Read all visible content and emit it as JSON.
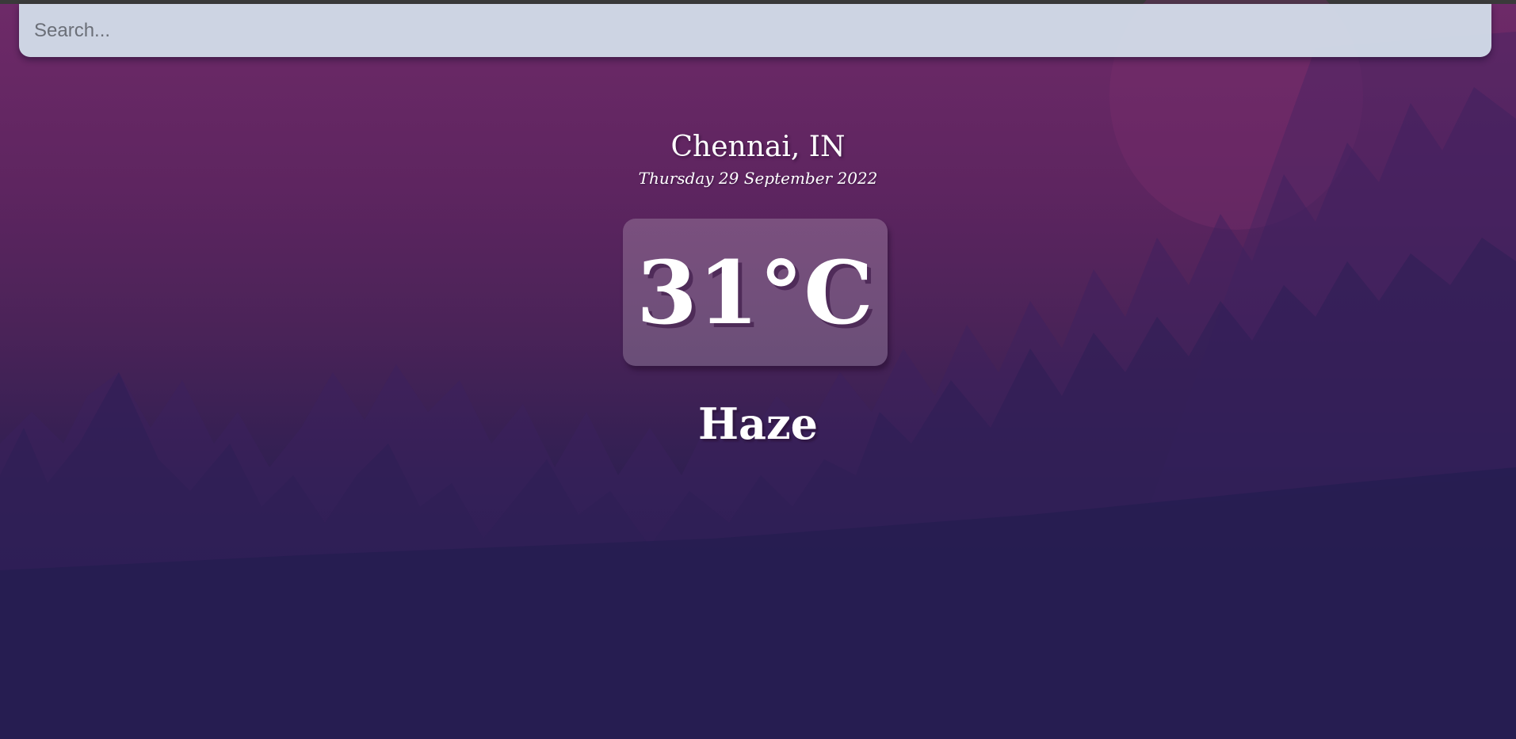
{
  "search": {
    "placeholder": "Search...",
    "value": ""
  },
  "weather": {
    "location": "Chennai, IN",
    "date": "Thursday 29 September 2022",
    "temperature": "31°C",
    "condition": "Haze"
  },
  "colors": {
    "bg_top": "#6e2a68",
    "bg_bottom": "#221c4e",
    "search_bar": "#d3ddea",
    "text": "#ffffff"
  }
}
